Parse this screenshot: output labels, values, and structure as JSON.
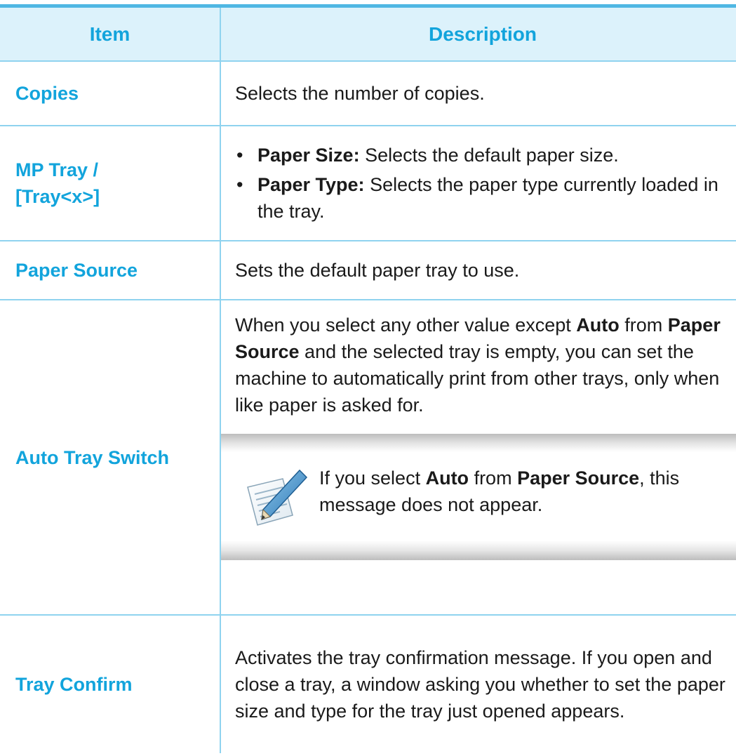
{
  "header": {
    "item": "Item",
    "description": "Description"
  },
  "rows": {
    "copies": {
      "item": "Copies",
      "desc": "Selects the number of copies."
    },
    "mp_tray": {
      "item_line1": "MP Tray /",
      "item_line2": "[Tray<x>]",
      "bullet1_label": "Paper Size:",
      "bullet1_text": " Selects the default paper size.",
      "bullet2_label": "Paper Type:",
      "bullet2_text": " Selects the paper type currently loaded in the tray."
    },
    "paper_source": {
      "item": "Paper Source",
      "desc": "Sets the default paper tray to use."
    },
    "auto_tray": {
      "item": "Auto Tray Switch",
      "t1": "When you select any other value except ",
      "b1": "Auto",
      "t2": " from ",
      "b2": "Paper Source",
      "t3": " and the selected tray is empty, you can set the machine to automatically print from other trays, only when like paper is asked for.",
      "note": {
        "t1": "If you select ",
        "b1": "Auto",
        "t2": " from ",
        "b2": "Paper Source",
        "t3": ", this message does not appear."
      }
    },
    "tray_confirm": {
      "item": "Tray Confirm",
      "desc": "Activates the tray confirmation message. If you open and close a tray, a window asking you whether to set the paper size and type for the tray just opened appears."
    }
  },
  "icons": {
    "note": "note-pencil-icon"
  },
  "colors": {
    "accent": "#12a4dc",
    "border": "#8fd3ef",
    "header_bg": "#dcf2fb"
  }
}
